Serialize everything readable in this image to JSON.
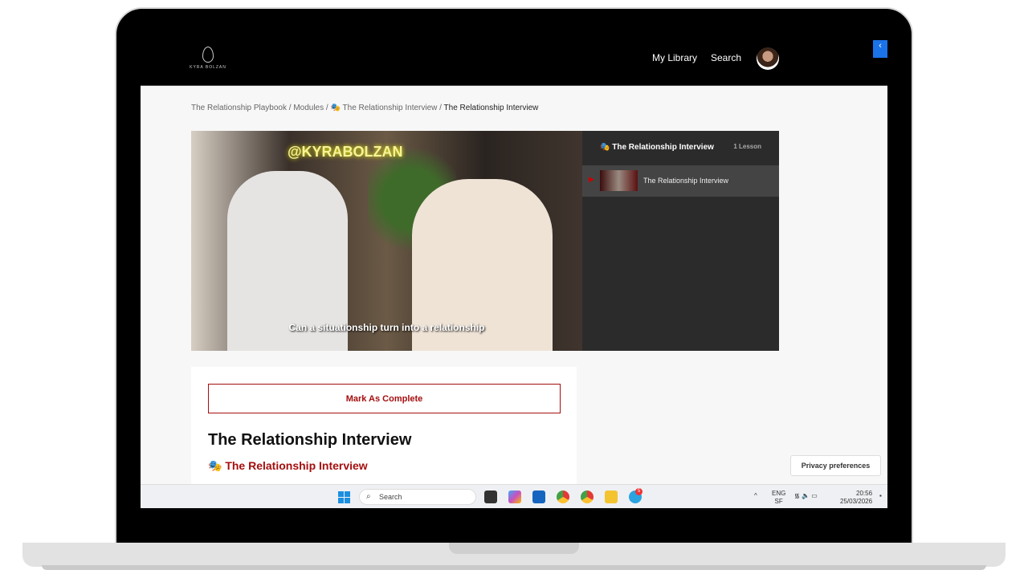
{
  "brand": {
    "logo_text": "KYRA BOLZAN"
  },
  "nav": {
    "my_library": "My Library",
    "search": "Search"
  },
  "breadcrumb": {
    "items": [
      "The Relationship Playbook",
      "Modules",
      "The Relationship Interview"
    ],
    "current": "The Relationship Interview",
    "separator": "/"
  },
  "video": {
    "overlay_handle": "@KYRABOLZAN",
    "caption": "Can a situationship turn into a relationship"
  },
  "playlist": {
    "title": "The Relationship Interview",
    "count": "1 Lesson",
    "lessons": [
      {
        "title": "The Relationship Interview"
      }
    ]
  },
  "lesson": {
    "mark_complete": "Mark As Complete",
    "title": "The Relationship Interview",
    "subtitle": "The Relationship Interview"
  },
  "privacy": {
    "label": "Privacy preferences"
  },
  "taskbar": {
    "search_placeholder": "Search",
    "language": "ENG",
    "layout": "SF",
    "time": "20:56",
    "date": "25/03/2026",
    "telegram_badge": "5"
  },
  "colors": {
    "accent": "#a50e0e",
    "collapse": "#1a73e8"
  }
}
